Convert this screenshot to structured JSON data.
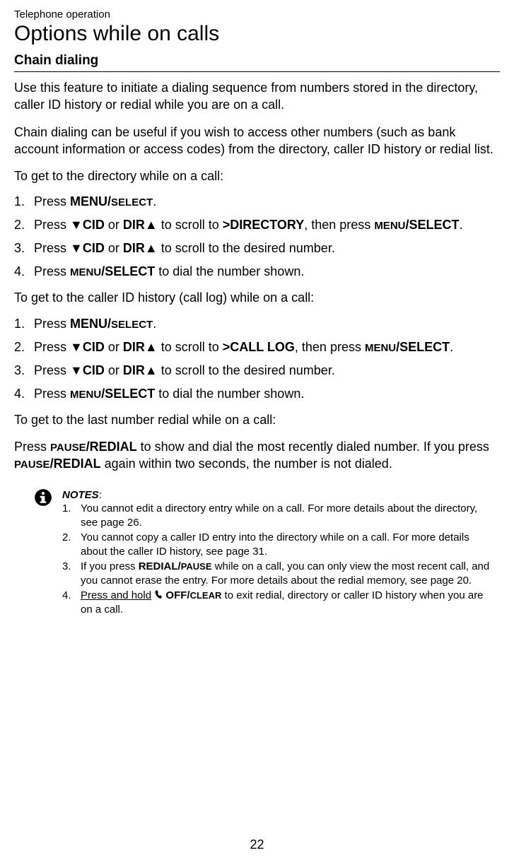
{
  "header": {
    "section": "Telephone operation",
    "title": "Options while on calls",
    "subtitle": "Chain dialing"
  },
  "intro1": "Use this feature to initiate a dialing sequence from numbers stored in the directory, caller ID history or redial while you are on a call.",
  "intro2": "Chain dialing can be useful if you wish to access other numbers (such as bank account information or access codes) from the directory, caller ID history or redial list.",
  "sec1_lead": "To get to the directory while on a call:",
  "sec1": [
    {
      "n": "1.",
      "pre": "Press ",
      "k1": "MENU/",
      "k1b": "SELECT",
      "post": "."
    },
    {
      "n": "2.",
      "pre": "Press ",
      "k1": "▼CID",
      "mid1": " or ",
      "k2": "DIR▲",
      "mid2": " to scroll to ",
      "k3": ">DIRECTORY",
      "mid3": ", then press ",
      "k4a": "MENU",
      "k4b": "/SELECT",
      "post": "."
    },
    {
      "n": "3.",
      "pre": "Press ",
      "k1": "▼CID",
      "mid1": " or ",
      "k2": "DIR▲",
      "mid2": " to scroll to the desired number.",
      "post": ""
    },
    {
      "n": "4.",
      "pre": "Press ",
      "k4a": "MENU",
      "k4b": "/SELECT",
      "mid2": " to dial the number shown.",
      "post": ""
    }
  ],
  "sec2_lead": "To get to the caller ID history (call log) while on a call:",
  "sec2": [
    {
      "n": "1.",
      "pre": "Press ",
      "k1": "MENU/",
      "k1b": "SELECT",
      "post": "."
    },
    {
      "n": "2.",
      "pre": "Press ",
      "k1": "▼CID",
      "mid1": " or ",
      "k2": "DIR▲",
      "mid2": " to scroll to ",
      "k3": ">CALL LOG",
      "mid3": ", then press ",
      "k4a": "MENU",
      "k4b": "/SELECT",
      "post": "."
    },
    {
      "n": "3.",
      "pre": "Press ",
      "k1": "▼CID",
      "mid1": " or ",
      "k2": "DIR▲",
      "mid2": " to scroll to the desired number.",
      "post": ""
    },
    {
      "n": "4.",
      "pre": "Press ",
      "k4a": "MENU",
      "k4b": "/SELECT",
      "mid2": " to dial the number shown.",
      "post": ""
    }
  ],
  "sec3_lead": "To get to the last number redial while on a call:",
  "sec3_p1": "Press ",
  "sec3_k1a": "PAUSE",
  "sec3_k1b": "/REDIAL",
  "sec3_p2": " to show and dial the most recently dialed number. If you press ",
  "sec3_k2a": "PAUSE",
  "sec3_k2b": "/REDIAL",
  "sec3_p3": " again within two seconds, the number is not dialed.",
  "notes": {
    "heading": "NOTES",
    "items": [
      {
        "n": "1.",
        "text": "You cannot edit a directory entry while on a call. For more details about the directory, see page 26."
      },
      {
        "n": "2.",
        "text": "You cannot copy a caller ID entry into the directory while on a call. For more details about the caller ID history, see page 31."
      },
      {
        "n": "3.",
        "pre": "If you press ",
        "k1": "REDIAL/",
        "k1b": "PAUSE",
        "post": " while on a call, you can only view the most recent call, and you cannot erase the entry. For more details about the redial memory, see page 20."
      },
      {
        "n": "4.",
        "u1": "Press and hold",
        "gap": " ",
        "k1": "OFF/",
        "k1b": "CLEAR",
        "post": " to exit redial, directory or caller ID history when you are on a call."
      }
    ]
  },
  "page_number": "22"
}
